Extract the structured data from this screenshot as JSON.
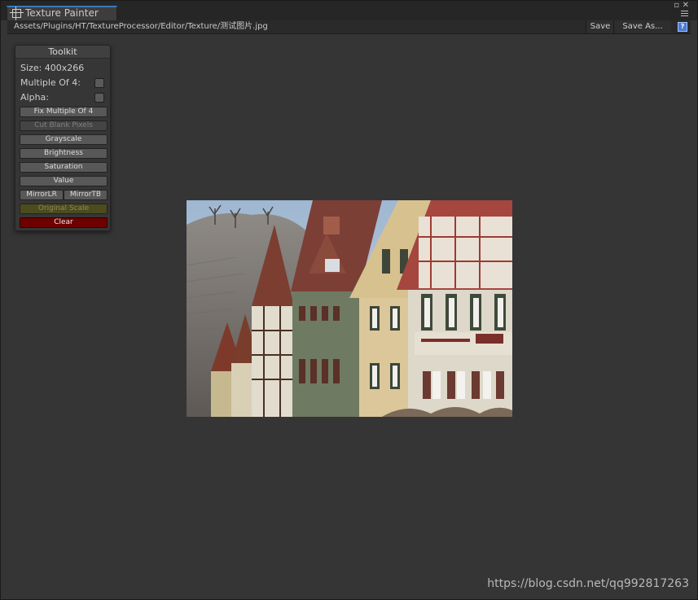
{
  "window": {
    "tab_title": "Texture Painter",
    "path": "Assets/Plugins/HT/TextureProcessor/Editor/Texture/测试图片.jpg",
    "save_label": "Save",
    "save_as_label": "Save As...",
    "help_glyph": "?",
    "restore_glyph": "▫",
    "close_glyph": "✕"
  },
  "toolkit": {
    "title": "Toolkit",
    "size_label": "Size: 400x266",
    "multiple_of_4_label": "Multiple Of 4:",
    "multiple_of_4_checked": false,
    "alpha_label": "Alpha:",
    "alpha_checked": false,
    "buttons": {
      "fix_multiple": "Fix Multiple Of 4",
      "cut_blank": "Cut Blank Pixels",
      "grayscale": "Grayscale",
      "brightness": "Brightness",
      "saturation": "Saturation",
      "value": "Value",
      "mirror_lr": "MirrorLR",
      "mirror_tb": "MirrorTB",
      "original_scale": "Original Scale",
      "clear": "Clear"
    }
  },
  "watermark": "https://blog.csdn.net/qq992817263",
  "colors": {
    "accent_tab": "#3a79bb",
    "clear_button": "#6e0000",
    "original_scale_button": "#4b4b1e"
  }
}
